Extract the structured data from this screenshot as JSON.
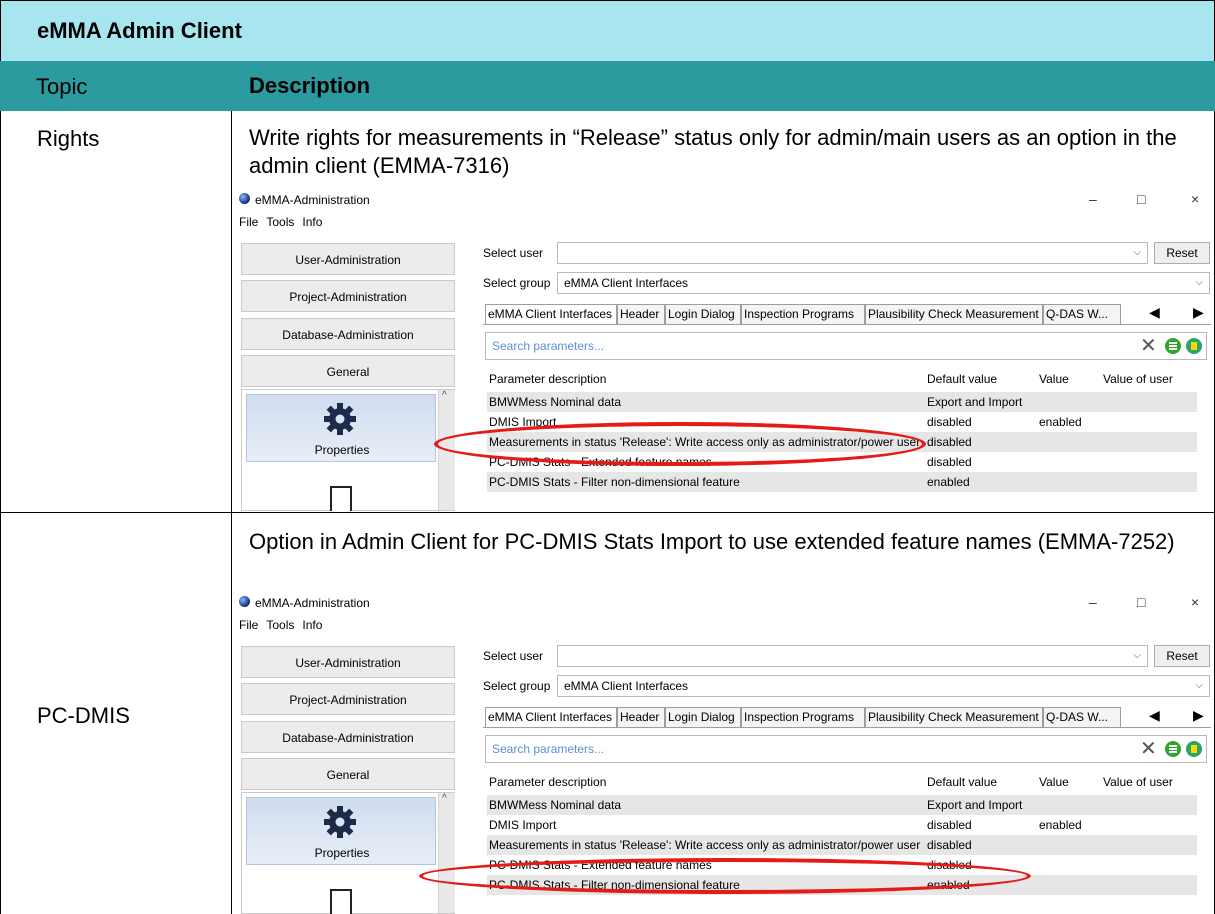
{
  "doc": {
    "title": "eMMA Admin Client",
    "col_topic": "Topic",
    "col_description": "Description",
    "rows": [
      {
        "topic": "Rights",
        "description": "Write rights for measurements in “Release” status only for admin/main users as an option in the admin client (EMMA-7316)"
      },
      {
        "topic": "PC-DMIS",
        "description": "Option in Admin Client for PC-DMIS Stats Import to use extended feature names (EMMA-7252)"
      }
    ]
  },
  "window": {
    "title": "eMMA-Administration",
    "min": "–",
    "max": "□",
    "close": "×",
    "menu": [
      "File",
      "Tools",
      "Info"
    ],
    "nav": [
      "User-Administration",
      "Project-Administration",
      "Database-Administration",
      "General"
    ],
    "properties_label": "Properties",
    "select_user_label": "Select user",
    "select_user_value": "",
    "reset_label": "Reset",
    "select_group_label": "Select group",
    "select_group_value": "eMMA Client Interfaces",
    "tabs": [
      "eMMA Client Interfaces",
      "Header",
      "Login Dialog",
      "Inspection Programs",
      "Plausibility Check Measurement",
      "Q-DAS W..."
    ],
    "search_placeholder": "Search parameters...",
    "table_headers": [
      "Parameter description",
      "Default value",
      "Value",
      "Value of user"
    ],
    "table_rows": [
      [
        "BMWMess Nominal data",
        "Export and Import",
        "",
        ""
      ],
      [
        "DMIS Import",
        "disabled",
        "enabled",
        ""
      ],
      [
        "Measurements in status 'Release': Write access only as administrator/power user",
        "disabled",
        "",
        ""
      ],
      [
        "PC-DMIS Stats - Extended feature names",
        "disabled",
        "",
        ""
      ],
      [
        "PC-DMIS Stats - Filter non-dimensional feature",
        "enabled",
        "",
        ""
      ]
    ]
  },
  "colors": {
    "title_bg": "#a8e6ef",
    "header_bg": "#2b9ba0",
    "highlight": "#e41b17"
  }
}
